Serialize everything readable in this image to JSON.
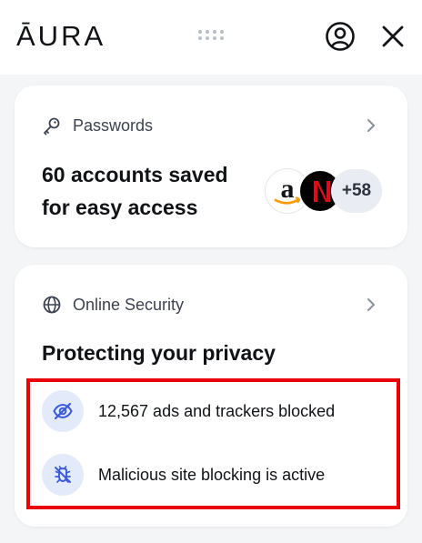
{
  "header": {
    "logo_text": "ĀURA",
    "drag_handle_icon": "grip-dots-icon",
    "account_icon": "user-circle-icon",
    "close_icon": "close-icon"
  },
  "passwords_card": {
    "title": "Passwords",
    "icon": "key-icon",
    "summary_line1": "60 accounts saved",
    "summary_line2": "for easy access",
    "account_logos": [
      "amazon",
      "netflix"
    ],
    "more_count": "+58"
  },
  "security_card": {
    "title": "Online Security",
    "icon": "globe-icon",
    "heading": "Protecting your privacy",
    "items": [
      {
        "icon": "eye-slash-icon",
        "text": "12,567 ads and trackers blocked"
      },
      {
        "icon": "shield-bug-icon",
        "text": "Malicious site blocking is active"
      }
    ]
  },
  "colors": {
    "accent_badge": "#e3ebfb",
    "icon_blue": "#3b5bdb",
    "highlight": "#e8000b",
    "netflix_red": "#e50914",
    "amazon_orange": "#ff9900"
  }
}
